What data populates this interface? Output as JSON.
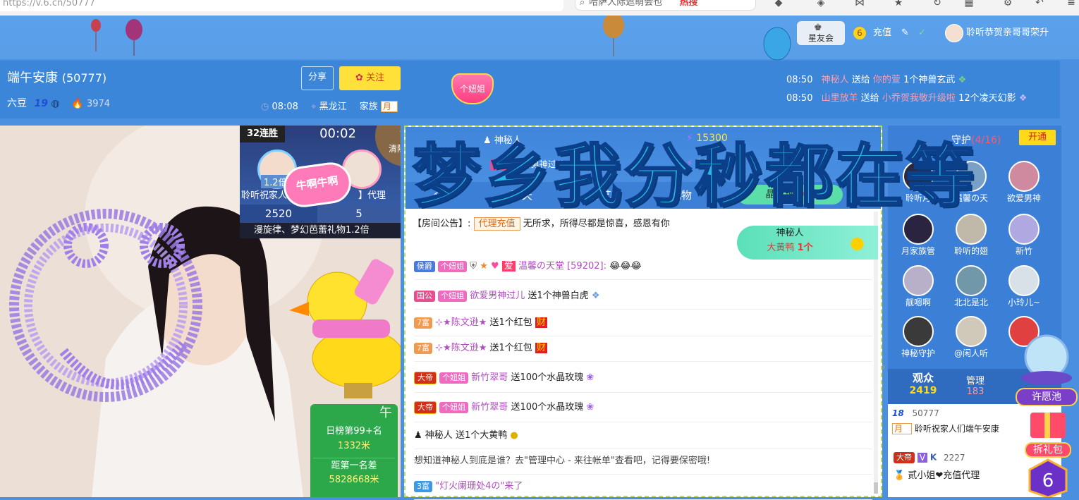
{
  "browser": {
    "url": "https://v.6.cn/50777",
    "search_text": "哈萨人际遮萌会也",
    "search_badge": "热搜"
  },
  "header": {
    "club": "星友会",
    "level": "6",
    "recharge": "充值",
    "username": "聆听恭贺亲哥哥荣升"
  },
  "room": {
    "title": "端午安康",
    "room_id": "(50777)",
    "beans_label": "六豆",
    "level_num": "19",
    "heat": "3974",
    "time": "08:08",
    "location": "黑龙江",
    "family_label": "家族",
    "family_tag": "月",
    "share": "分享",
    "follow": "关注",
    "tag_center": "个妞姐"
  },
  "gift_feed": [
    {
      "time": "08:50",
      "from": "神秘人",
      "verb": "送给",
      "to": "你的萱",
      "gift": "1个神兽玄武"
    },
    {
      "time": "08:50",
      "from": "山里放羊",
      "verb": "送给",
      "to": "小乔贺我敬升级啦",
      "gift": "12个凌天幻影"
    }
  ],
  "pk": {
    "streak": "32连胜",
    "timer": "00:02",
    "clear_effects": "清除特效",
    "multiplier": "1.2倍",
    "left_name": "聆听祝家人",
    "right_name": "】代理",
    "left_score": "2520",
    "right_score": "5",
    "ticker": "漫旋律、梦幻芭蕾礼物1.2倍",
    "sticker": "牛啊牛啊"
  },
  "rank": {
    "daily_rank": "日榜第99+名",
    "distance_m": "1332米",
    "gap_label": "距第一名差",
    "gap_value": "5828668米",
    "partial_label": "午"
  },
  "chat_top": {
    "mystery": "神秘人",
    "score": "15300",
    "score2": "39",
    "rich_tag": "国公",
    "rich_name": "欲爱男神过儿",
    "tabs": [
      "全部",
      "聊天",
      "点艺",
      "礼物"
    ],
    "gift_btn": "晶玫瑰",
    "gift_count": "0个"
  },
  "mystery_popup": {
    "name": "神秘人",
    "gift": "大黄鸭",
    "count": "1个"
  },
  "announcement": {
    "label": "【房间公告】:",
    "tag": "代理充值",
    "text": "无所求，所得尽都是惊喜，感恩有你"
  },
  "chat": [
    {
      "badge": "侯爵",
      "badge2": "个妞姐",
      "nick": "温馨の天堂",
      "extra": "[59202]:",
      "msg": "😂😂😂"
    },
    {
      "badge": "国公",
      "badge2": "个妞姐",
      "nick": "欲爱男神过儿",
      "extra": "",
      "msg": "送1个神兽白虎"
    },
    {
      "badge": "7富",
      "badge2": "",
      "nick": "⊹★陈文逊★",
      "extra": "",
      "msg": "送1个红包"
    },
    {
      "badge": "7富",
      "badge2": "",
      "nick": "⊹★陈文逊★",
      "extra": "",
      "msg": "送1个红包"
    },
    {
      "badge": "大帝",
      "badge2": "个妞姐",
      "nick": "新竹翠哥",
      "extra": "",
      "msg": "送100个水晶玫瑰"
    },
    {
      "badge": "大帝",
      "badge2": "个妞姐",
      "nick": "新竹翠哥",
      "extra": "",
      "msg": "送100个水晶玫瑰"
    },
    {
      "badge": "",
      "badge2": "",
      "nick": "神秘人",
      "extra": "",
      "msg": "送1个大黄鸭"
    },
    {
      "badge": "",
      "badge2": "",
      "nick": "",
      "extra": "",
      "msg": "想知道神秘人到底是谁？去\"管理中心 - 来往帐单\"查看吧，记得要保密哦!"
    },
    {
      "badge": "3富",
      "badge2": "",
      "nick": "\"灯火阑珊处4の\"来了",
      "extra": "",
      "msg": ""
    }
  ],
  "guards": {
    "title": "守护",
    "count": "(4/16)",
    "open_btn": "开通",
    "row0": [
      "聆听月",
      "温馨の天",
      "欲爱男神"
    ],
    "row1": [
      "月家族管",
      "聆听的翅",
      "新竹"
    ],
    "row2": [
      "靓嗯啊",
      "北北是北",
      "小玲儿~"
    ],
    "row3": [
      "神秘守护",
      "@闲人听",
      ""
    ]
  },
  "audience": {
    "audience_label": "观众",
    "audience_count": "2419",
    "admin_label": "管理",
    "admin_count": "183",
    "user1_level": "18",
    "user1_id": "50777",
    "user1_tag": "月",
    "user1_name": "聆听祝家人们端午安康",
    "user2_badge": "大帝",
    "user2_id": "2227",
    "user2_name": "贰小姐❤充值代理"
  },
  "sidebar": {
    "wish_pool": "许愿池",
    "gift_pack": "拆礼包"
  },
  "overlay_text": "梦乡我分秒都在等",
  "colors": {
    "accent_blue": "#3c86d9",
    "follow_yellow": "#ffe13a",
    "rank_green": "#2ca84a",
    "overlay_cyan": "#2bb6e6"
  }
}
